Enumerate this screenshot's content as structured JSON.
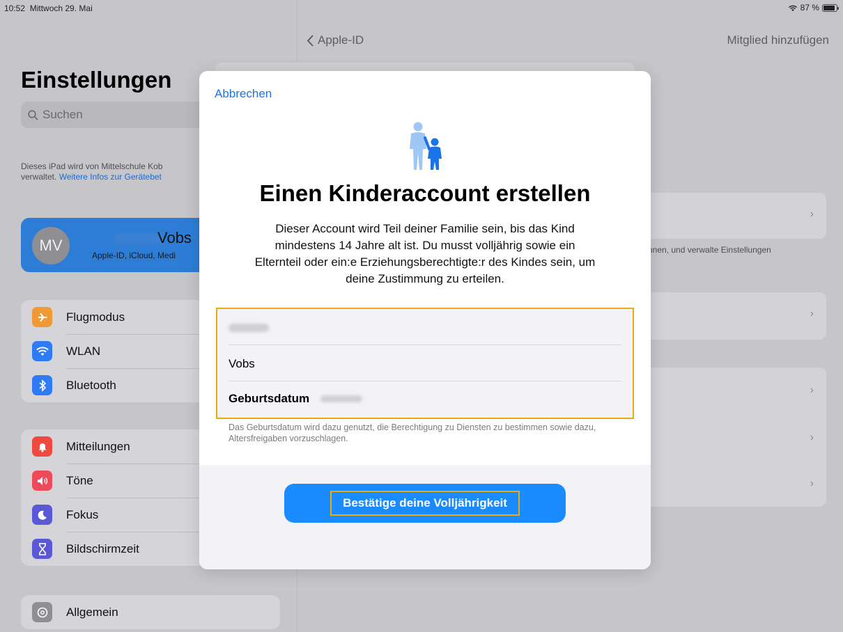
{
  "status_bar": {
    "time": "10:52",
    "date": "Mittwoch 29. Mai",
    "battery_percent": "87 %",
    "battery_level": 0.87
  },
  "sidebar": {
    "title": "Einstellungen",
    "search_placeholder": "Suchen",
    "managed_text": "Dieses iPad wird von Mittelschule Kob",
    "managed_text_2": "verwaltet.",
    "managed_link": "Weitere Infos zur Gerätebet",
    "profile": {
      "initials": "MV",
      "last_name": "Vobs",
      "subtitle": "Apple-ID, iCloud, Medi"
    },
    "group1": [
      {
        "label": "Flugmodus",
        "icon": "airplane-icon",
        "color": "#f09a37"
      },
      {
        "label": "WLAN",
        "icon": "wifi-icon",
        "color": "#2f7bf6"
      },
      {
        "label": "Bluetooth",
        "icon": "bluetooth-icon",
        "color": "#2f7bf6"
      }
    ],
    "group2": [
      {
        "label": "Mitteilungen",
        "icon": "notifications-icon",
        "color": "#ee4a40"
      },
      {
        "label": "Töne",
        "icon": "sound-icon",
        "color": "#ee4a5a"
      },
      {
        "label": "Fokus",
        "icon": "moon-icon",
        "color": "#5b58d6"
      },
      {
        "label": "Bildschirmzeit",
        "icon": "hourglass-icon",
        "color": "#5b58d6"
      }
    ],
    "group3": [
      {
        "label": "Allgemein",
        "icon": "gear-icon",
        "color": "#8e8e93"
      }
    ]
  },
  "detail": {
    "back_label": "Apple-ID",
    "add_member_label": "Mitglied hinzufügen",
    "note_text": "nnen, und verwalte Einstellungen"
  },
  "modal": {
    "cancel_label": "Abbrechen",
    "title": "Einen Kinderaccount erstellen",
    "description": "Dieser Account wird Teil deiner Familie sein, bis das Kind mindestens 14 Jahre alt ist. Du musst volljährig sowie ein Elternteil oder ein:e Erziehungsberechtigte:r des Kindes sein, um deine Zustimmung zu erteilen.",
    "last_name_value": "Vobs",
    "birthdate_label": "Geburtsdatum",
    "footnote": "Das Geburtsdatum wird dazu genutzt, die Berechtigung zu Diensten zu bestimmen sowie dazu, Altersfreigaben vorzuschlagen.",
    "confirm_button": "Bestätige deine Volljährigkeit"
  }
}
